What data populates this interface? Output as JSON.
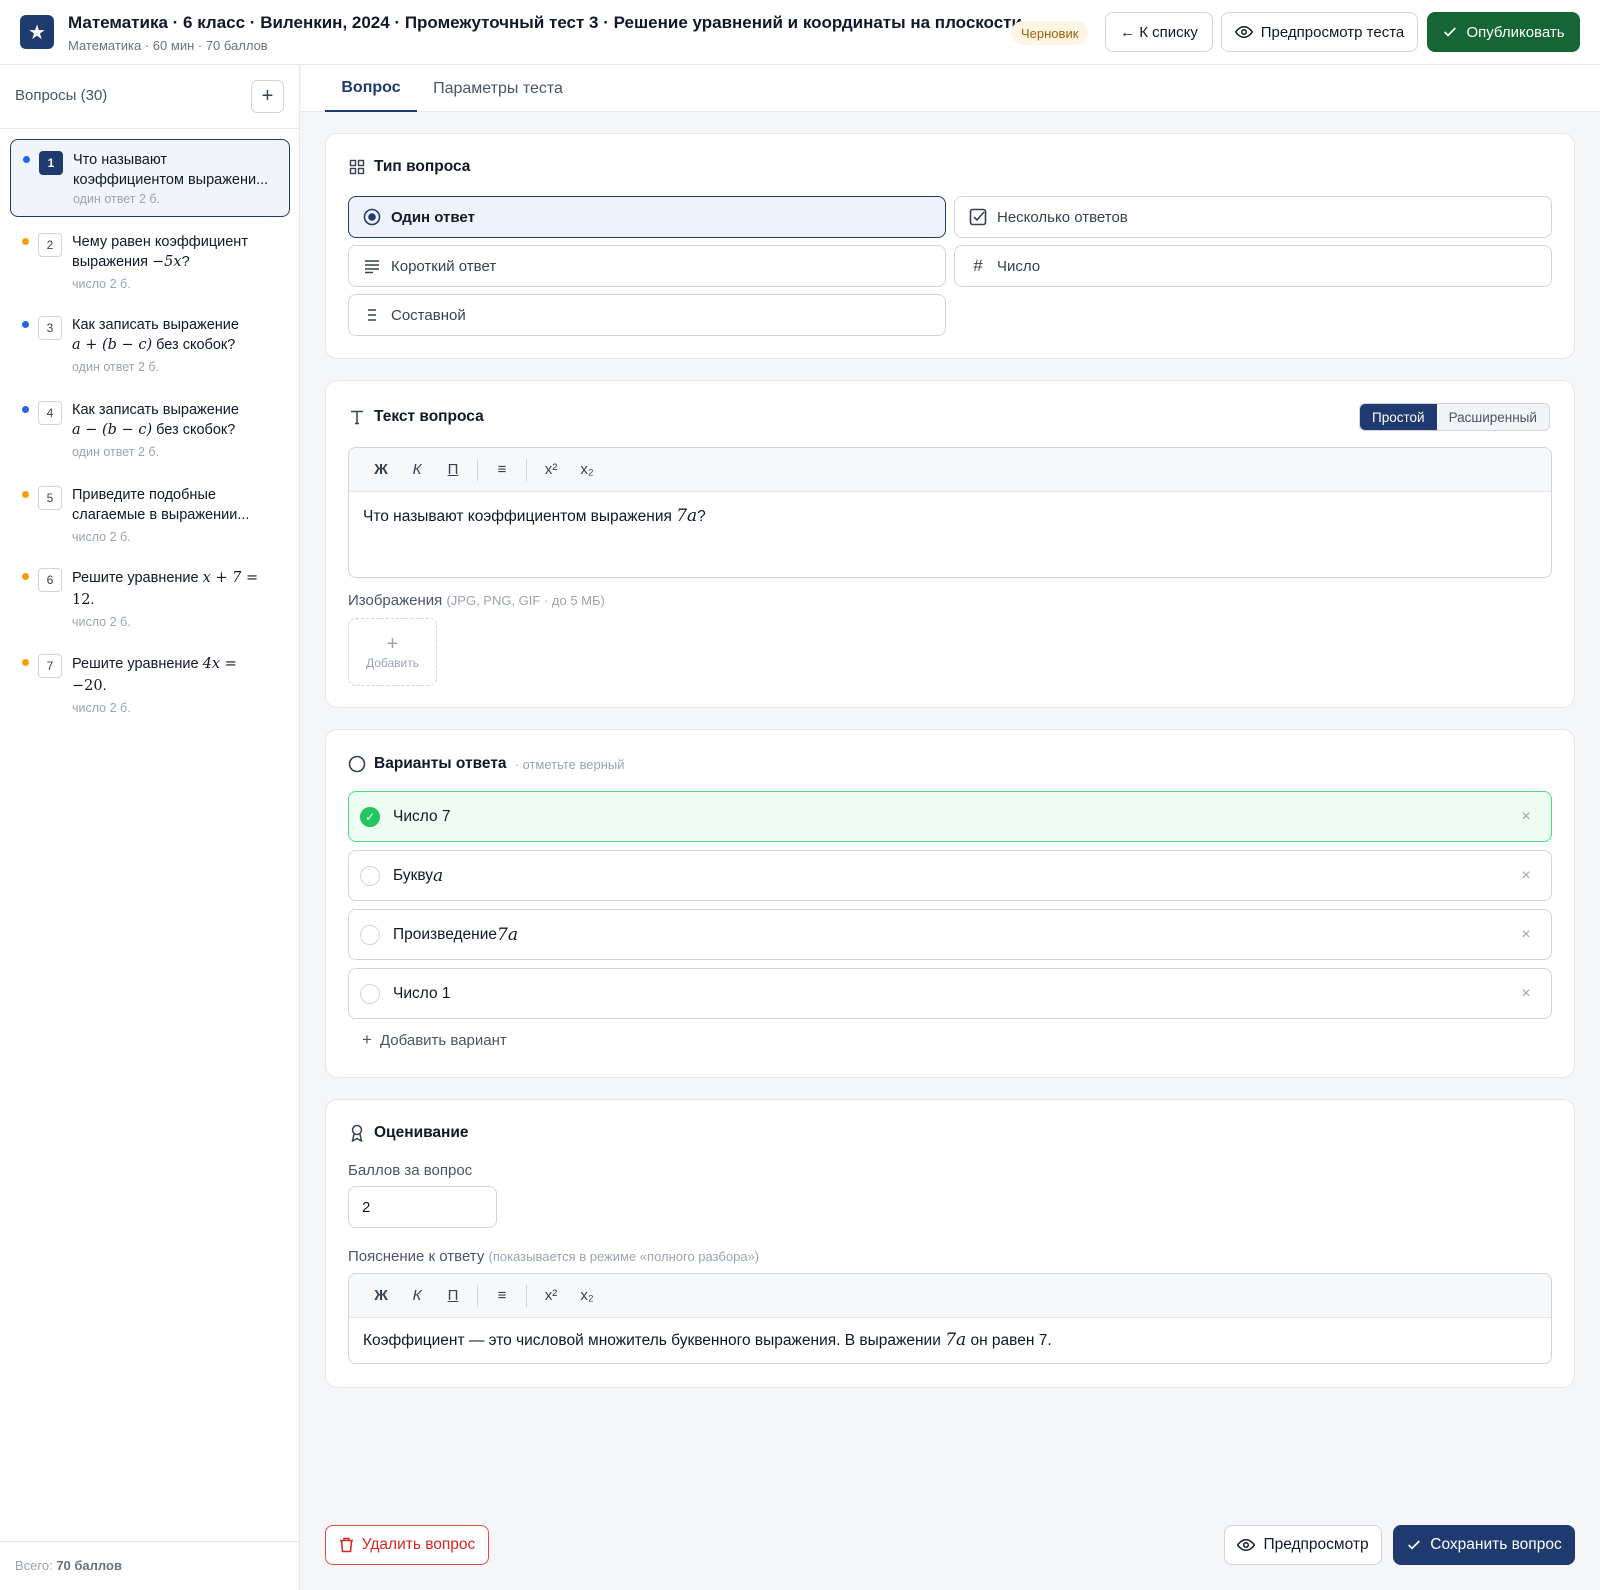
{
  "header": {
    "title": "Математика · 6 класс · Виленкин, 2024 · Промежуточный тест 3 · Решение уравнений и координаты на плоскости",
    "subtitle": "Математика · 60 мин · 70 баллов",
    "status": "Черновик",
    "back_label": "← К списку",
    "preview_label": "Предпросмотр теста",
    "publish_label": "Опубликовать",
    "logo_glyph": "★"
  },
  "sidebar": {
    "title": "Вопросы (30)",
    "add_glyph": "+",
    "total_label": "Всего:",
    "total_value": "70 баллов",
    "items": [
      {
        "num": "1",
        "pre": "Что называют коэффициентом выражени...",
        "math": "",
        "post": "",
        "line2pre": "",
        "line2math": "",
        "line2post": "",
        "meta": "один ответ  2 б.",
        "dot": "#2563eb"
      },
      {
        "num": "2",
        "pre": "Чему равен коэффициент",
        "math": "",
        "post": "",
        "line2pre": "выражения ",
        "line2math": "−5x",
        "line2post": "?",
        "meta": "число  2 б.",
        "dot": "#f59e0b"
      },
      {
        "num": "3",
        "pre": "Как записать выражение",
        "math": "",
        "post": "",
        "line2pre": "",
        "line2math": "a + (b − c)",
        "line2post": " без скобок?",
        "meta": "один ответ  2 б.",
        "dot": "#2563eb"
      },
      {
        "num": "4",
        "pre": "Как записать выражение",
        "math": "",
        "post": "",
        "line2pre": "",
        "line2math": "a − (b − c)",
        "line2post": " без скобок?",
        "meta": "один ответ  2 б.",
        "dot": "#2563eb"
      },
      {
        "num": "5",
        "pre": "Приведите подобные",
        "math": "",
        "post": "",
        "line2pre": "слагаемые в выражении...",
        "line2math": "",
        "line2post": "",
        "meta": "число  2 б.",
        "dot": "#f59e0b"
      },
      {
        "num": "6",
        "pre": "Решите уравнение ",
        "math": "x + 7 =",
        "post": "",
        "line2pre": "",
        "line2math": "12",
        "line2post": ".",
        "meta": "число  2 б.",
        "dot": "#f59e0b"
      },
      {
        "num": "7",
        "pre": "Решите уравнение ",
        "math": "4x =",
        "post": "",
        "line2pre": "",
        "line2math": "−20",
        "line2post": ".",
        "meta": "число  2 б.",
        "dot": "#f59e0b"
      }
    ]
  },
  "tabs": [
    {
      "label": "Вопрос",
      "active": true
    },
    {
      "label": "Параметры теста",
      "active": false
    }
  ],
  "type_section": {
    "title": "Тип вопроса",
    "options": [
      {
        "label": "Один ответ",
        "icon": "radio-target-icon",
        "selected": true
      },
      {
        "label": "Несколько ответов",
        "icon": "checkbox-icon",
        "selected": false
      },
      {
        "label": "Короткий ответ",
        "icon": "text-lines-icon",
        "selected": false
      },
      {
        "label": "Число",
        "icon": "hash-icon",
        "selected": false
      },
      {
        "label": "Составной",
        "icon": "list-icon",
        "selected": false
      }
    ]
  },
  "question_text": {
    "title": "Текст вопроса",
    "mode_simple": "Простой",
    "mode_advanced": "Расширенный",
    "toolbar": {
      "bold": "Ж",
      "italic": "К",
      "underline": "П",
      "list": "≡",
      "sup": "x²",
      "sub": "x₂"
    },
    "text_pre": "Что называют коэффициентом выражения ",
    "text_math": "7a",
    "text_post": "?",
    "images_label": "Изображения",
    "images_hint": "(JPG, PNG, GIF · до 5 МБ)",
    "add_image_glyph": "+",
    "add_image_label": "Добавить"
  },
  "answers": {
    "title": "Варианты ответа",
    "hint": "· отметьте верный",
    "items": [
      {
        "pre": "Число 7",
        "math": "",
        "correct": true
      },
      {
        "pre": "Букву",
        "math": "a",
        "correct": false
      },
      {
        "pre": "Произведение",
        "math": "7a",
        "correct": false
      },
      {
        "pre": "Число 1",
        "math": "",
        "correct": false
      }
    ],
    "add_label": "Добавить вариант",
    "remove_glyph": "×",
    "check_glyph": "✓"
  },
  "grading": {
    "title": "Оценивание",
    "points_label": "Баллов за вопрос",
    "points_value": "2",
    "explanation_label": "Пояснение к ответу",
    "explanation_hint": "(показывается в режиме «полного разбора»)",
    "explanation_pre": "Коэффициент — это числовой множитель буквенного выражения. В выражении ",
    "explanation_math": "7a",
    "explanation_post": " он равен 7."
  },
  "footer": {
    "delete_label": "Удалить вопрос",
    "preview_label": "Предпросмотр",
    "save_label": "Сохранить вопрос"
  },
  "colors": {
    "brand": "#1e3a6e",
    "publish": "#166534",
    "correct": "#22c55e",
    "danger": "#dc2626"
  }
}
